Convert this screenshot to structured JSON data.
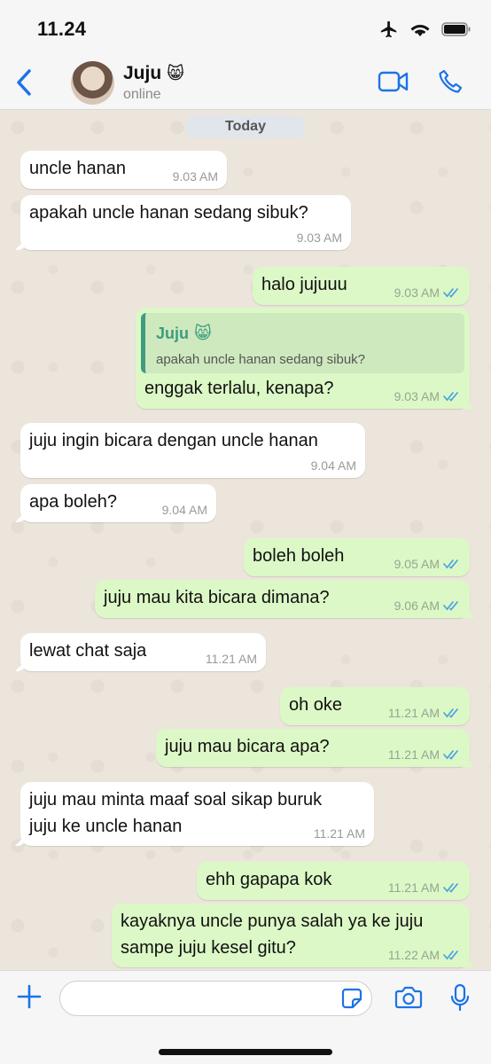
{
  "status_bar": {
    "time": "11.24"
  },
  "header": {
    "contact_name": "Juju",
    "contact_emoji": "😸",
    "contact_status": "online",
    "icons": [
      "chevron-left-icon",
      "video-call-icon",
      "phone-icon"
    ]
  },
  "chat": {
    "date_label": "Today",
    "messages": [
      {
        "direction": "in",
        "text": "uncle hanan",
        "time": "9.03 AM"
      },
      {
        "direction": "in",
        "text": "apakah uncle hanan sedang sibuk?",
        "time": "9.03 AM"
      },
      {
        "direction": "out",
        "text": "halo jujuuu",
        "time": "9.03 AM",
        "read": true
      },
      {
        "direction": "out",
        "quoted_name": "Juju",
        "quoted_emoji": "😸",
        "quoted_text": "apakah uncle hanan sedang sibuk?",
        "text": "enggak terlalu, kenapa?",
        "time": "9.03 AM",
        "read": true
      },
      {
        "direction": "in",
        "text": "juju ingin bicara dengan uncle hanan",
        "time": "9.04 AM"
      },
      {
        "direction": "in",
        "text": "apa boleh?",
        "time": "9.04 AM"
      },
      {
        "direction": "out",
        "text": "boleh boleh",
        "time": "9.05 AM",
        "read": true
      },
      {
        "direction": "out",
        "text": "juju mau kita bicara dimana?",
        "time": "9.06 AM",
        "read": true
      },
      {
        "direction": "in",
        "text": "lewat chat saja",
        "time": "11.21 AM"
      },
      {
        "direction": "out",
        "text": "oh oke",
        "time": "11.21 AM",
        "read": true
      },
      {
        "direction": "out",
        "text": "juju mau bicara apa?",
        "time": "11.21 AM",
        "read": true
      },
      {
        "direction": "in",
        "text_lines": [
          "juju mau minta maaf soal sikap buruk",
          "juju ke uncle hanan"
        ],
        "time": "11.21 AM"
      },
      {
        "direction": "out",
        "text": "ehh gapapa kok",
        "time": "11.21 AM",
        "read": true
      },
      {
        "direction": "out",
        "text_lines": [
          "kayaknya uncle punya salah ya ke juju",
          "sampe juju kesel gitu?"
        ],
        "time": "11.22 AM",
        "read": true
      }
    ]
  },
  "input_bar": {
    "message_value": "",
    "icons": [
      "plus-icon",
      "sticker-icon",
      "camera-icon",
      "microphone-icon"
    ]
  },
  "colors": {
    "accent": "#1a73e8",
    "incoming_bubble": "#ffffff",
    "outgoing_bubble": "#dcf8c6",
    "read_ticks": "#4aa3df",
    "quote_bar": "#3e9c7e"
  }
}
